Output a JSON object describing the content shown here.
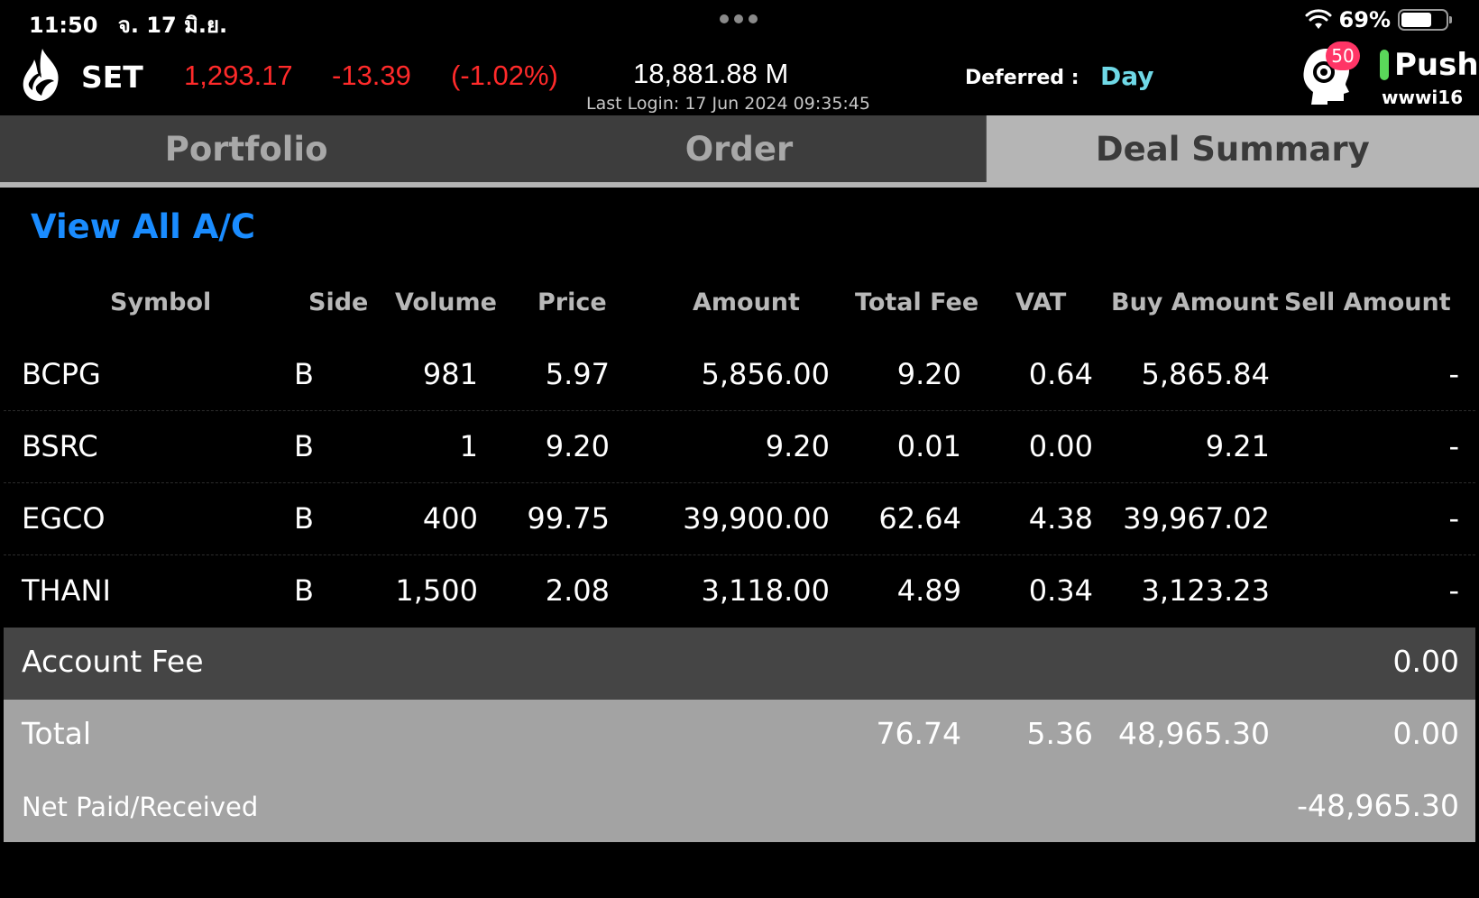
{
  "status_bar": {
    "time": "11:50",
    "date": "จ. 17 มิ.ย.",
    "battery": "69%",
    "battery_level": 0.69
  },
  "header": {
    "market": "SET",
    "index_value": "1,293.17",
    "index_change": "-13.39",
    "index_change_pct": "(-1.02%)",
    "volume": "18,881.88 M",
    "last_login": "Last Login: 17 Jun 2024 09:35:45",
    "deferred_label": "Deferred :",
    "deferred_value": "Day",
    "notification_count": "50",
    "push_label": "Push",
    "username": "wwwi16"
  },
  "tabs": [
    {
      "label": "Portfolio",
      "active": false
    },
    {
      "label": "Order",
      "active": false
    },
    {
      "label": "Deal Summary",
      "active": true
    }
  ],
  "view_all_label": "View All A/C",
  "table": {
    "headers": {
      "symbol": "Symbol",
      "side": "Side",
      "volume": "Volume",
      "price": "Price",
      "amount": "Amount",
      "total_fee": "Total Fee",
      "vat": "VAT",
      "buy_amount": "Buy Amount",
      "sell_amount": "Sell Amount"
    },
    "rows": [
      {
        "symbol": "BCPG",
        "side": "B",
        "volume": "981",
        "price": "5.97",
        "amount": "5,856.00",
        "total_fee": "9.20",
        "vat": "0.64",
        "buy_amount": "5,865.84",
        "sell_amount": "-"
      },
      {
        "symbol": "BSRC",
        "side": "B",
        "volume": "1",
        "price": "9.20",
        "amount": "9.20",
        "total_fee": "0.01",
        "vat": "0.00",
        "buy_amount": "9.21",
        "sell_amount": "-"
      },
      {
        "symbol": "EGCO",
        "side": "B",
        "volume": "400",
        "price": "99.75",
        "amount": "39,900.00",
        "total_fee": "62.64",
        "vat": "4.38",
        "buy_amount": "39,967.02",
        "sell_amount": "-"
      },
      {
        "symbol": "THANI",
        "side": "B",
        "volume": "1,500",
        "price": "2.08",
        "amount": "3,118.00",
        "total_fee": "4.89",
        "vat": "0.34",
        "buy_amount": "3,123.23",
        "sell_amount": "-"
      }
    ]
  },
  "account_fee": {
    "label": "Account Fee",
    "value": "0.00"
  },
  "total": {
    "label": "Total",
    "total_fee": "76.74",
    "vat": "5.36",
    "buy_amount": "48,965.30",
    "sell_amount": "0.00"
  },
  "net": {
    "label": "Net Paid/Received",
    "value": "-48,965.30"
  }
}
